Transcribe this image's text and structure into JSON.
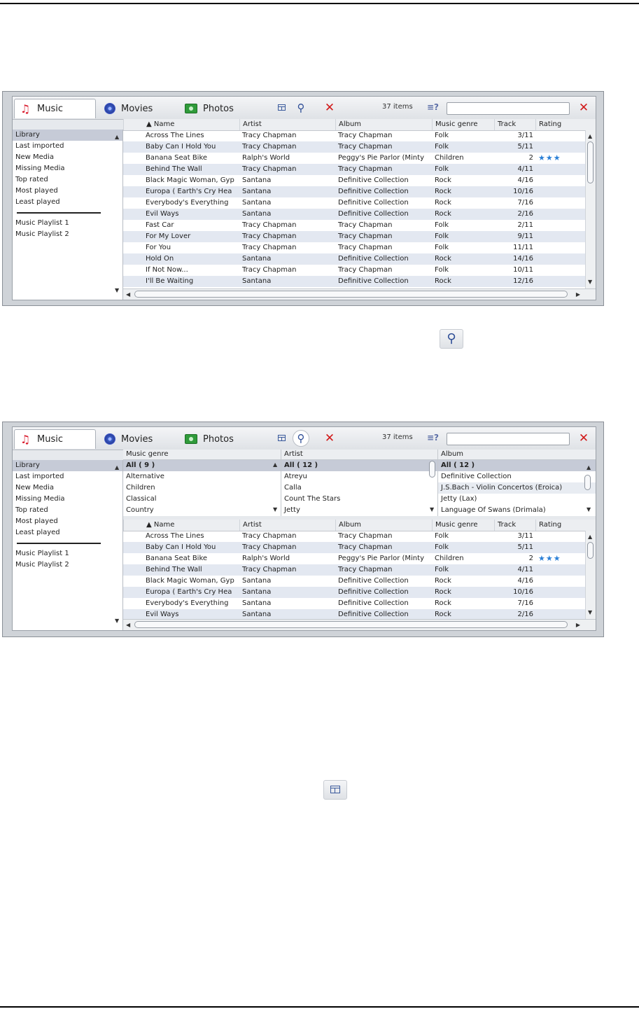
{
  "tabs": [
    {
      "label": "Music",
      "icon": "music-note-icon"
    },
    {
      "label": "Movies",
      "icon": "film-reel-icon"
    },
    {
      "label": "Photos",
      "icon": "camera-icon"
    }
  ],
  "toolbar": {
    "item_count": "37 items",
    "search_value": "",
    "filter_icon": "filter-help-icon"
  },
  "sidebar": {
    "items": [
      "Library",
      "Last imported",
      "New Media",
      "Missing Media",
      "Top rated",
      "Most played",
      "Least played"
    ],
    "playlists": [
      "Music Playlist 1",
      "Music Playlist 2"
    ]
  },
  "columns": [
    "▲ Name",
    "Artist",
    "Album",
    "Music genre",
    "Track",
    "Rating"
  ],
  "tracks": [
    {
      "name": "Across The Lines",
      "artist": "Tracy Chapman",
      "album": "Tracy Chapman",
      "genre": "Folk",
      "track": "3/11",
      "rating": ""
    },
    {
      "name": "Baby Can I Hold You",
      "artist": "Tracy Chapman",
      "album": "Tracy Chapman",
      "genre": "Folk",
      "track": "5/11",
      "rating": ""
    },
    {
      "name": "Banana Seat Bike",
      "artist": "Ralph's World",
      "album": "Peggy's Pie Parlor (Minty",
      "genre": "Children",
      "track": "2",
      "rating": "★★★"
    },
    {
      "name": "Behind The Wall",
      "artist": "Tracy Chapman",
      "album": "Tracy Chapman",
      "genre": "Folk",
      "track": "4/11",
      "rating": ""
    },
    {
      "name": "Black Magic Woman, Gyp",
      "artist": "Santana",
      "album": "Definitive Collection",
      "genre": "Rock",
      "track": "4/16",
      "rating": ""
    },
    {
      "name": "Europa ( Earth's Cry Hea",
      "artist": "Santana",
      "album": "Definitive Collection",
      "genre": "Rock",
      "track": "10/16",
      "rating": ""
    },
    {
      "name": "Everybody's Everything",
      "artist": "Santana",
      "album": "Definitive Collection",
      "genre": "Rock",
      "track": "7/16",
      "rating": ""
    },
    {
      "name": "Evil Ways",
      "artist": "Santana",
      "album": "Definitive Collection",
      "genre": "Rock",
      "track": "2/16",
      "rating": ""
    },
    {
      "name": "Fast Car",
      "artist": "Tracy Chapman",
      "album": "Tracy Chapman",
      "genre": "Folk",
      "track": "2/11",
      "rating": ""
    },
    {
      "name": "For My Lover",
      "artist": "Tracy Chapman",
      "album": "Tracy Chapman",
      "genre": "Folk",
      "track": "9/11",
      "rating": ""
    },
    {
      "name": "For You",
      "artist": "Tracy Chapman",
      "album": "Tracy Chapman",
      "genre": "Folk",
      "track": "11/11",
      "rating": ""
    },
    {
      "name": "Hold On",
      "artist": "Santana",
      "album": "Definitive Collection",
      "genre": "Rock",
      "track": "14/16",
      "rating": ""
    },
    {
      "name": "If Not Now...",
      "artist": "Tracy Chapman",
      "album": "Tracy Chapman",
      "genre": "Folk",
      "track": "10/11",
      "rating": ""
    },
    {
      "name": "I'll Be Waiting",
      "artist": "Santana",
      "album": "Definitive Collection",
      "genre": "Rock",
      "track": "12/16",
      "rating": ""
    }
  ],
  "browser": {
    "panes": [
      {
        "header": "Music genre",
        "items": [
          "All ( 9 )",
          "Alternative",
          "Children",
          "Classical",
          "Country"
        ]
      },
      {
        "header": "Artist",
        "items": [
          "All ( 12 )",
          "Atreyu",
          "Calla",
          "Count The Stars",
          "Jetty"
        ]
      },
      {
        "header": "Album",
        "items": [
          "All ( 12 )",
          "Definitive Collection",
          "J.S.Bach - Violin Concertos (Eroica)",
          "Jetty (Lax)",
          "Language Of Swans (Drimala)"
        ]
      }
    ]
  },
  "second_tracks": [
    {
      "name": "Across The Lines",
      "artist": "Tracy Chapman",
      "album": "Tracy Chapman",
      "genre": "Folk",
      "track": "3/11",
      "rating": ""
    },
    {
      "name": "Baby Can I Hold You",
      "artist": "Tracy Chapman",
      "album": "Tracy Chapman",
      "genre": "Folk",
      "track": "5/11",
      "rating": ""
    },
    {
      "name": "Banana Seat Bike",
      "artist": "Ralph's World",
      "album": "Peggy's Pie Parlor (Minty",
      "genre": "Children",
      "track": "2",
      "rating": "★★★"
    },
    {
      "name": "Behind The Wall",
      "artist": "Tracy Chapman",
      "album": "Tracy Chapman",
      "genre": "Folk",
      "track": "4/11",
      "rating": ""
    },
    {
      "name": "Black Magic Woman, Gyp",
      "artist": "Santana",
      "album": "Definitive Collection",
      "genre": "Rock",
      "track": "4/16",
      "rating": ""
    },
    {
      "name": "Europa ( Earth's Cry Hea",
      "artist": "Santana",
      "album": "Definitive Collection",
      "genre": "Rock",
      "track": "10/16",
      "rating": ""
    },
    {
      "name": "Everybody's Everything",
      "artist": "Santana",
      "album": "Definitive Collection",
      "genre": "Rock",
      "track": "7/16",
      "rating": ""
    },
    {
      "name": "Evil Ways",
      "artist": "Santana",
      "album": "Definitive Collection",
      "genre": "Rock",
      "track": "2/16",
      "rating": ""
    }
  ],
  "colors": {
    "accent_red": "#d11a1a",
    "selection": "#c6cbd7",
    "row_alt": "#e3e8f1",
    "star_blue": "#2a7fd6"
  }
}
